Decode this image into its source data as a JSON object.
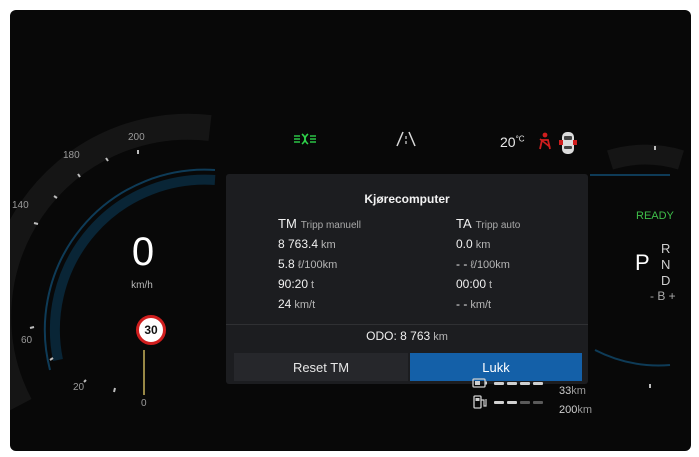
{
  "speedometer": {
    "speed": "0",
    "unit": "km/h",
    "scale_labels": [
      "200",
      "180",
      "140",
      "60",
      "20",
      "0"
    ],
    "speed_limit": "30"
  },
  "status_bar": {
    "temperature": "20",
    "temperature_unit": "°C",
    "icons": [
      "low-beam-indicator-icon",
      "road-icon",
      "seatbelt-warning-icon",
      "car-doors-icon"
    ]
  },
  "drivetrain": {
    "ready_label": "READY",
    "gears": {
      "p": "P",
      "r": "R",
      "n": "N",
      "d": "D",
      "b": "- B +"
    }
  },
  "trip_computer": {
    "title": "Kjørecomputer",
    "manual": {
      "code": "TM",
      "name": "Tripp manuell",
      "distance": "8 763.4",
      "distance_unit": "km",
      "consumption": "5.8",
      "consumption_unit": "ℓ/100km",
      "time": "90:20",
      "time_unit": "t",
      "avg_speed": "24",
      "avg_speed_unit": "km/t"
    },
    "auto": {
      "code": "TA",
      "name": "Tripp auto",
      "distance": "0.0",
      "distance_unit": "km",
      "consumption": "- -",
      "consumption_unit": "ℓ/100km",
      "time": "00:00",
      "time_unit": "t",
      "avg_speed": "- -",
      "avg_speed_unit": "km/t"
    },
    "odo_label": "ODO:",
    "odo_value": "8 763",
    "odo_unit": "km",
    "reset_label": "Reset TM",
    "close_label": "Lukk"
  },
  "range_info": {
    "electric_range": "33",
    "electric_unit": "km",
    "fuel_range": "200",
    "fuel_unit": "km"
  },
  "colors": {
    "accent_blue": "#1460a8",
    "ready_green": "#3fbf4a",
    "indicator_green": "#2fd14a",
    "warning_red": "#d01e1e"
  }
}
